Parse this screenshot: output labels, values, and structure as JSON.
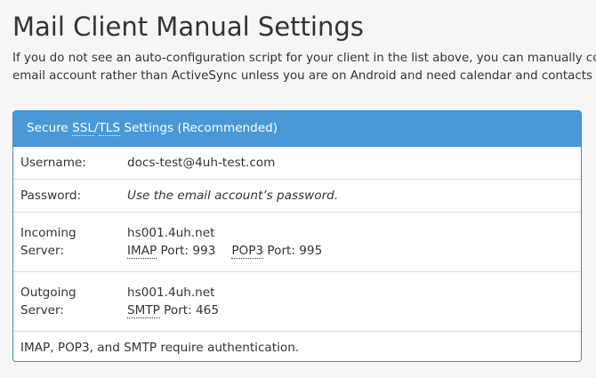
{
  "page": {
    "title": "Mail Client Manual Settings",
    "intro_line1": "If you do not see an auto-configuration script for your client in the list above, you can manually configure your mail client using the settings below:",
    "intro_line2": "email account rather than ActiveSync unless you are on Android and need calendar and contacts support."
  },
  "panel": {
    "heading_prefix": "Secure ",
    "heading_abbr1": "SSL",
    "heading_sep": "/",
    "heading_abbr2": "TLS",
    "heading_suffix": " Settings (Recommended)",
    "rows": {
      "username": {
        "label": "Username:",
        "value": "docs-test@4uh-test.com"
      },
      "password": {
        "label": "Password:",
        "value": "Use the email account’s password."
      },
      "incoming": {
        "label_line1": "Incoming",
        "label_line2": "Server:",
        "host": "hs001.4uh.net",
        "imap_abbr": "IMAP",
        "imap_port": " Port: 993",
        "pop3_abbr": "POP3",
        "pop3_port": " Port: 995"
      },
      "outgoing": {
        "label_line1": "Outgoing",
        "label_line2": "Server:",
        "host": "hs001.4uh.net",
        "smtp_abbr": "SMTP",
        "smtp_port": " Port: 465"
      }
    },
    "footnote": "IMAP, POP3, and SMTP require authentication."
  },
  "colors": {
    "panel_header": "#4a98d6",
    "panel_border": "#3c8dcf",
    "page_background": "#f6f6f6",
    "text": "#333333"
  }
}
